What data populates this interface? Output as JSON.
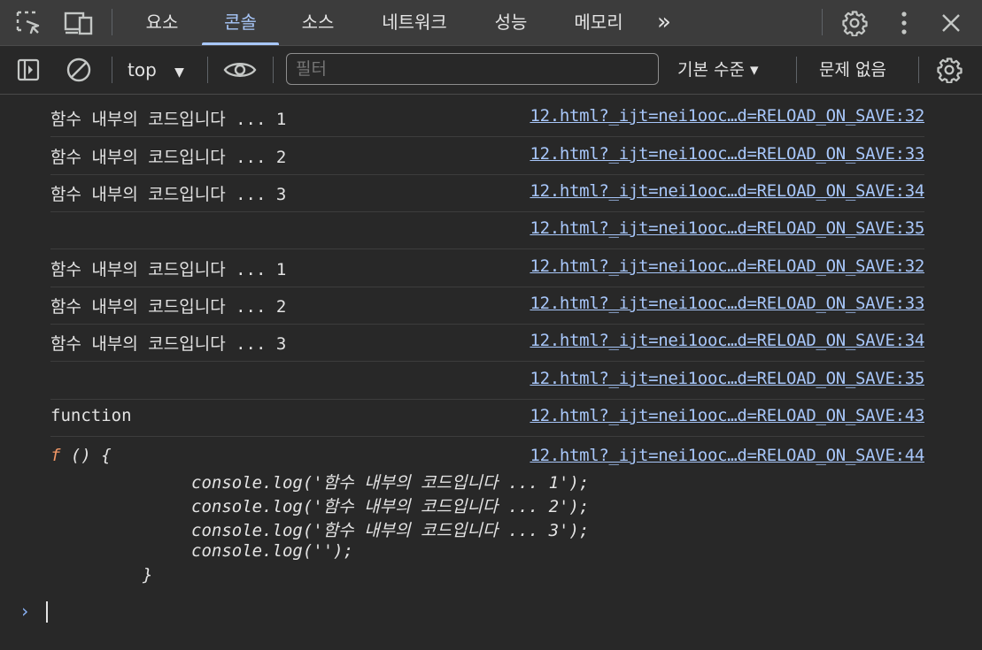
{
  "tabs": [
    {
      "label": "요소"
    },
    {
      "label": "콘솔"
    },
    {
      "label": "소스"
    },
    {
      "label": "네트워크"
    },
    {
      "label": "성능"
    },
    {
      "label": "메모리"
    }
  ],
  "more_tabs": "»",
  "toolbar": {
    "context": "top",
    "filter_placeholder": "필터",
    "log_level": "기본 수준 ▾",
    "issues": "문제 없음"
  },
  "console": {
    "rows": [
      {
        "msg": "함수 내부의 코드입니다 ... 1",
        "src": "12.html?_ijt=nei1ooc…d=RELOAD_ON_SAVE:32"
      },
      {
        "msg": "함수 내부의 코드입니다 ... 2",
        "src": "12.html?_ijt=nei1ooc…d=RELOAD_ON_SAVE:33"
      },
      {
        "msg": "함수 내부의 코드입니다 ... 3",
        "src": "12.html?_ijt=nei1ooc…d=RELOAD_ON_SAVE:34"
      },
      {
        "msg": "",
        "src": "12.html?_ijt=nei1ooc…d=RELOAD_ON_SAVE:35"
      },
      {
        "msg": "함수 내부의 코드입니다 ... 1",
        "src": "12.html?_ijt=nei1ooc…d=RELOAD_ON_SAVE:32"
      },
      {
        "msg": "함수 내부의 코드입니다 ... 2",
        "src": "12.html?_ijt=nei1ooc…d=RELOAD_ON_SAVE:33"
      },
      {
        "msg": "함수 내부의 코드입니다 ... 3",
        "src": "12.html?_ijt=nei1ooc…d=RELOAD_ON_SAVE:34"
      },
      {
        "msg": "",
        "src": "12.html?_ijt=nei1ooc…d=RELOAD_ON_SAVE:35"
      },
      {
        "msg": "function",
        "src": "12.html?_ijt=nei1ooc…d=RELOAD_ON_SAVE:43"
      }
    ],
    "function_entry": {
      "keyword": "f",
      "signature": " () {",
      "src": "12.html?_ijt=nei1ooc…d=RELOAD_ON_SAVE:44",
      "body": [
        "console.log('함수 내부의 코드입니다 ... 1');",
        "console.log('함수 내부의 코드입니다 ... 2');",
        "console.log('함수 내부의 코드입니다 ... 3');",
        "console.log('');"
      ],
      "closing": "}"
    },
    "prompt": "›"
  }
}
